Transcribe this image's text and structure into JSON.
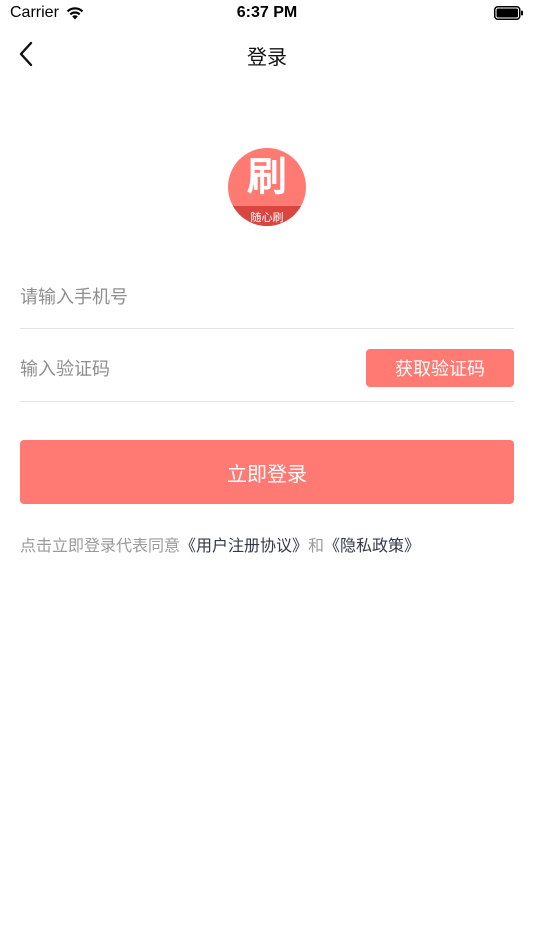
{
  "status_bar": {
    "carrier": "Carrier",
    "time": "6:37 PM"
  },
  "nav": {
    "title": "登录",
    "back_icon": "chevron-left-icon"
  },
  "logo": {
    "main_char": "刷",
    "sub_text": "随心刷",
    "color": "#ff7a72",
    "band_color": "#d8463f"
  },
  "form": {
    "phone_placeholder": "请输入手机号",
    "phone_value": "",
    "code_placeholder": "输入验证码",
    "code_value": "",
    "get_code_label": "获取验证码",
    "login_label": "立即登录"
  },
  "agreement": {
    "prefix": "点击立即登录代表同意",
    "user_agreement": "《用户注册协议》",
    "conjunction": "和",
    "privacy_policy": "《隐私政策》"
  },
  "colors": {
    "accent": "#ff7a72",
    "link": "#33374a",
    "muted": "#9a9a9a"
  }
}
